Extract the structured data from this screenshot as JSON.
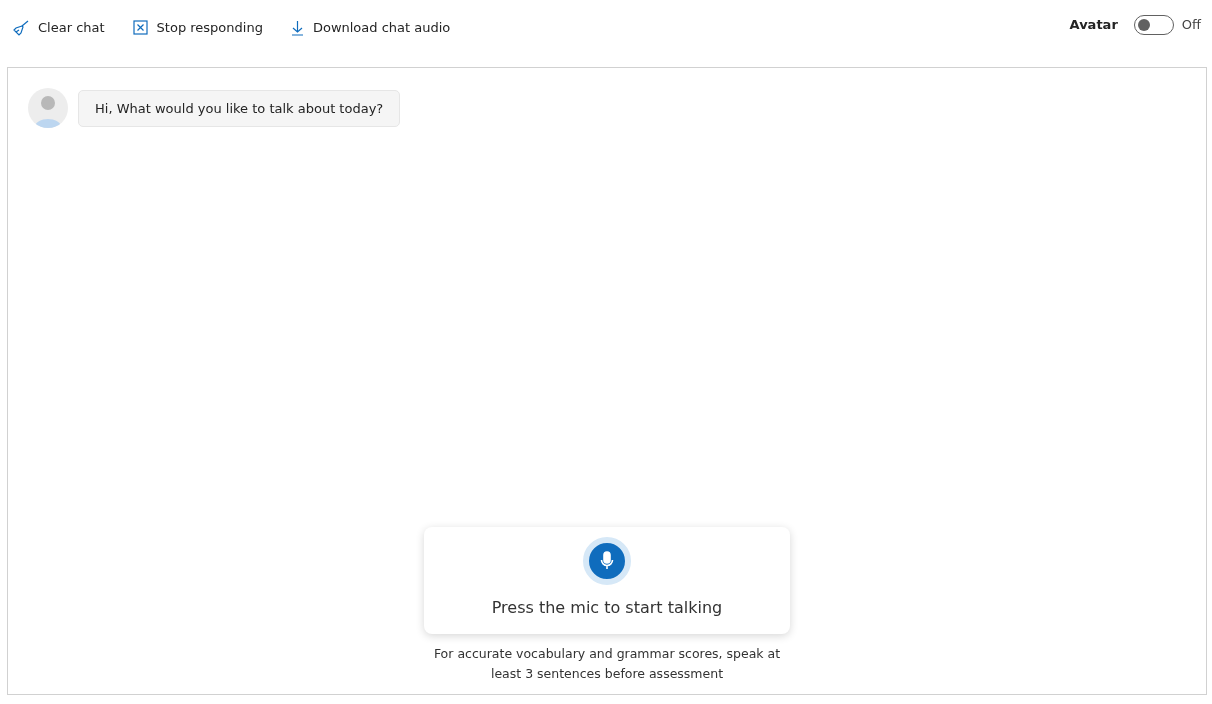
{
  "toolbar": {
    "actions": [
      {
        "kind": "clear",
        "label": "Clear chat"
      },
      {
        "kind": "stop",
        "label": "Stop responding"
      },
      {
        "kind": "download",
        "label": "Download chat audio"
      }
    ],
    "avatar_toggle": {
      "label": "Avatar",
      "on": false,
      "state_text": "Off"
    }
  },
  "chat": {
    "messages": [
      {
        "text": "Hi, What would you like to talk about today?"
      }
    ]
  },
  "mic_card": {
    "prompt": "Press the mic to start talking"
  },
  "hint": "For accurate vocabulary and grammar scores, speak at least 3 sentences before assessment"
}
